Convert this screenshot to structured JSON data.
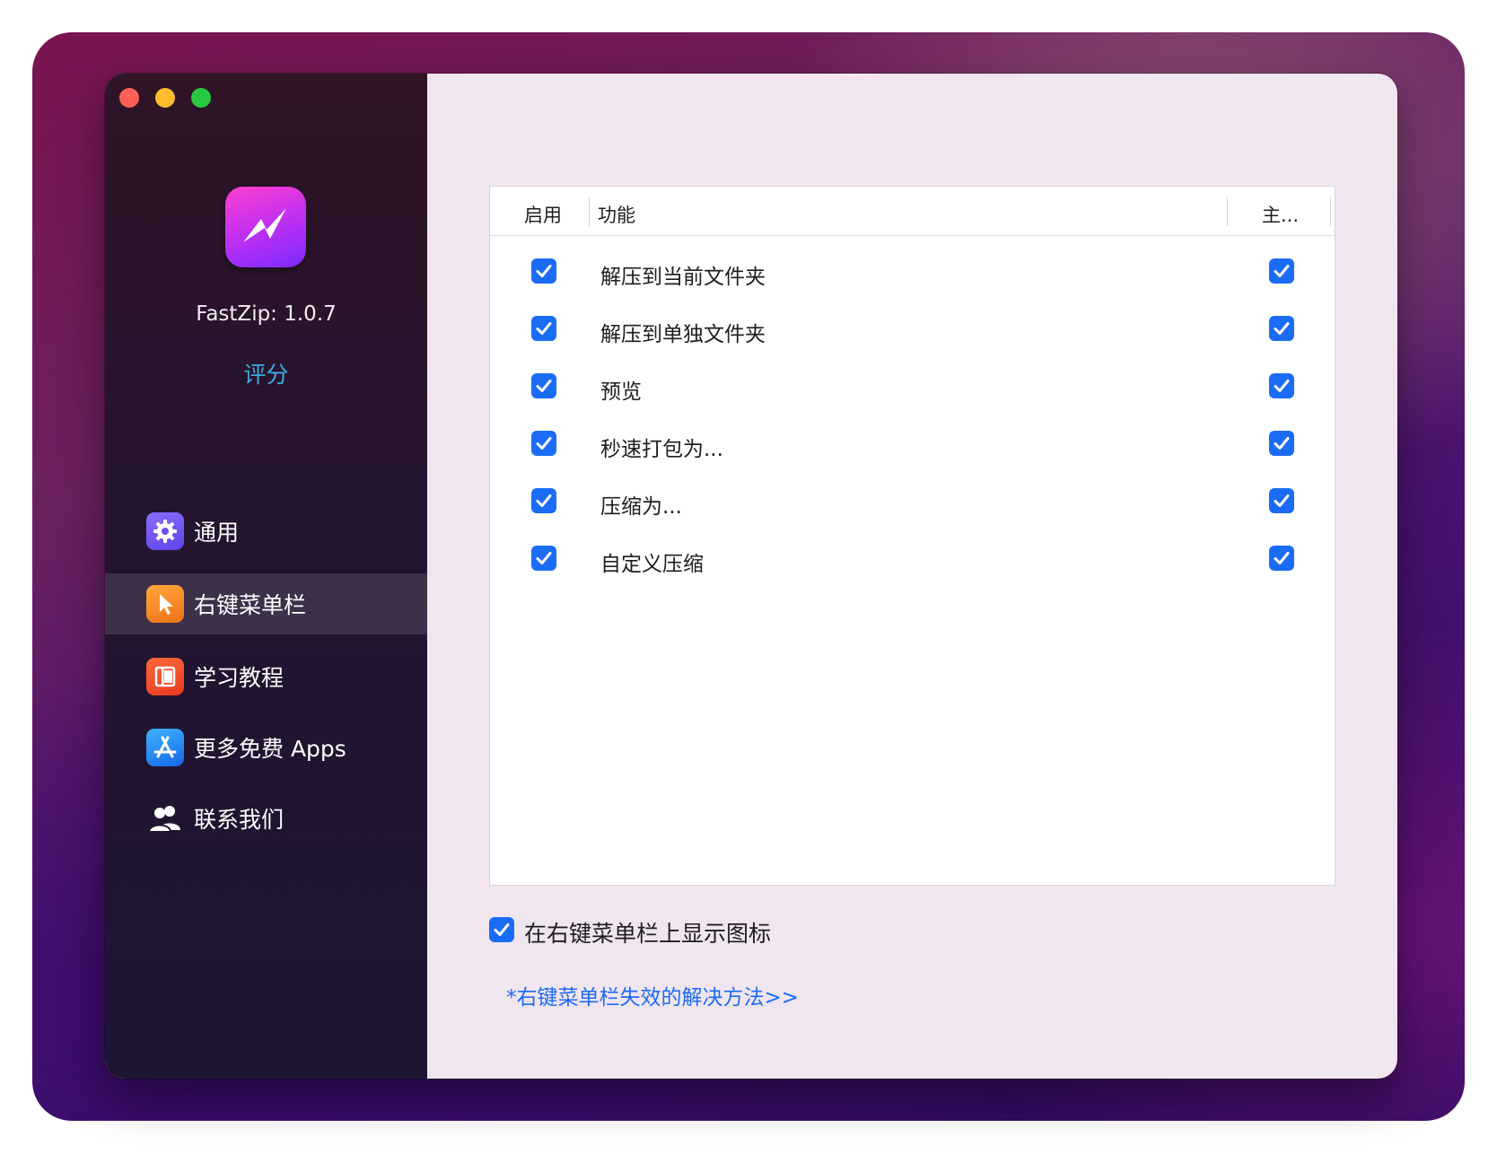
{
  "app": {
    "version_label": "FastZip: 1.0.7",
    "rate_label": "评分",
    "icon": "lightning-bolt-icon"
  },
  "sidebar": {
    "items": [
      {
        "label": "通用",
        "icon": "gear-icon",
        "color": "#7b5cf5"
      },
      {
        "label": "右键菜单栏",
        "icon": "cursor-pointer-icon",
        "color": "#f5901e",
        "selected": true
      },
      {
        "label": "学习教程",
        "icon": "book-icon",
        "color": "#f0502a"
      },
      {
        "label": "更多免费 Apps",
        "icon": "app-store-icon",
        "color": "#1f8ef5"
      },
      {
        "label": "联系我们",
        "icon": "people-icon",
        "color": "#ffffff"
      }
    ]
  },
  "table": {
    "headers": {
      "enable": "启用",
      "feature": "功能",
      "main": "主..."
    },
    "rows": [
      {
        "label": "解压到当前文件夹",
        "enabled": true,
        "main": true
      },
      {
        "label": "解压到单独文件夹",
        "enabled": true,
        "main": true
      },
      {
        "label": "预览",
        "enabled": true,
        "main": true
      },
      {
        "label": "秒速打包为...",
        "enabled": true,
        "main": true
      },
      {
        "label": "压缩为...",
        "enabled": true,
        "main": true
      },
      {
        "label": "自定义压缩",
        "enabled": true,
        "main": true
      }
    ]
  },
  "footer": {
    "show_icon_label": "在右键菜单栏上显示图标",
    "show_icon_checked": true,
    "help_link": "*右键菜单栏失效的解决方法>>"
  },
  "colors": {
    "accent": "#1a6cf7",
    "sidebar_bg": "#241430",
    "content_bg": "#f1e5ef",
    "link": "#3fa9e6"
  }
}
